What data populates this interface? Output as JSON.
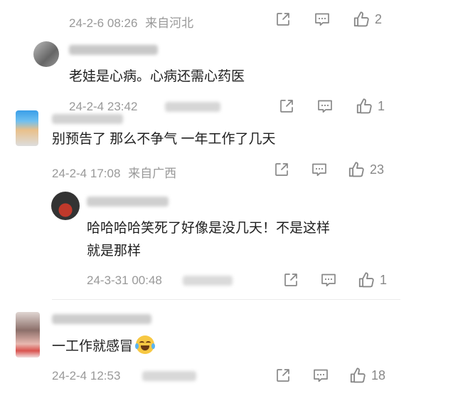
{
  "comments": [
    {
      "id": "c0",
      "meta": {
        "date": "24-2-6 08:26",
        "location": "来自河北"
      },
      "likes": "2"
    },
    {
      "id": "c1",
      "text": "老娃是心病。心病还需心药医",
      "meta": {
        "date": "24-2-4 23:42"
      },
      "likes": "1"
    },
    {
      "id": "c2",
      "text": "别预告了 那么不争气 一年工作了几天",
      "meta": {
        "date": "24-2-4 17:08",
        "location": "来自广西"
      },
      "likes": "23"
    },
    {
      "id": "c3",
      "text_line1": "哈哈哈哈笑死了好像是没几天！不是这样",
      "text_line2": "就是那样",
      "meta": {
        "date": "24-3-31 00:48"
      },
      "likes": "1"
    },
    {
      "id": "c4",
      "text": "一工作就感冒",
      "emoji": "crying-laughing-emoji",
      "meta": {
        "date": "24-2-4 12:53"
      },
      "likes": "18"
    }
  ],
  "icons": {
    "share": "share-icon",
    "reply": "comment-icon",
    "like": "thumbs-up-icon"
  },
  "colors": {
    "text_primary": "#1e1e1e",
    "text_meta": "#999999",
    "icon": "#888888",
    "background": "#ffffff"
  }
}
